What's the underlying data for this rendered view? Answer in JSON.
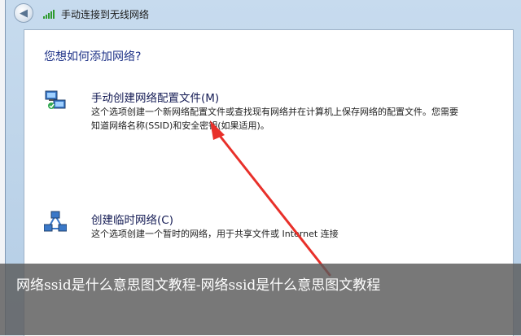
{
  "window": {
    "title": "手动连接到无线网络"
  },
  "content": {
    "heading": "您想如何添加网络?",
    "options": [
      {
        "title": "手动创建网络配置文件(M)",
        "description": "这个选项创建一个新网络配置文件或查找现有网络并在计算机上保存网络的配置文件。您需要知道网络名称(SSID)和安全密钥(如果适用)。",
        "icon": "network-computers-icon"
      },
      {
        "title": "创建临时网络(C)",
        "description": "这个选项创建一个暂时的网络，用于共享文件或 Internet 连接",
        "icon": "adhoc-network-icon"
      }
    ]
  },
  "caption": {
    "text": "网络ssid是什么意思图文教程-网络ssid是什么意思图文教程"
  },
  "colors": {
    "heading": "#1e3287",
    "arrow": "#e8302a",
    "caption_bg": "#5a5a5a"
  }
}
